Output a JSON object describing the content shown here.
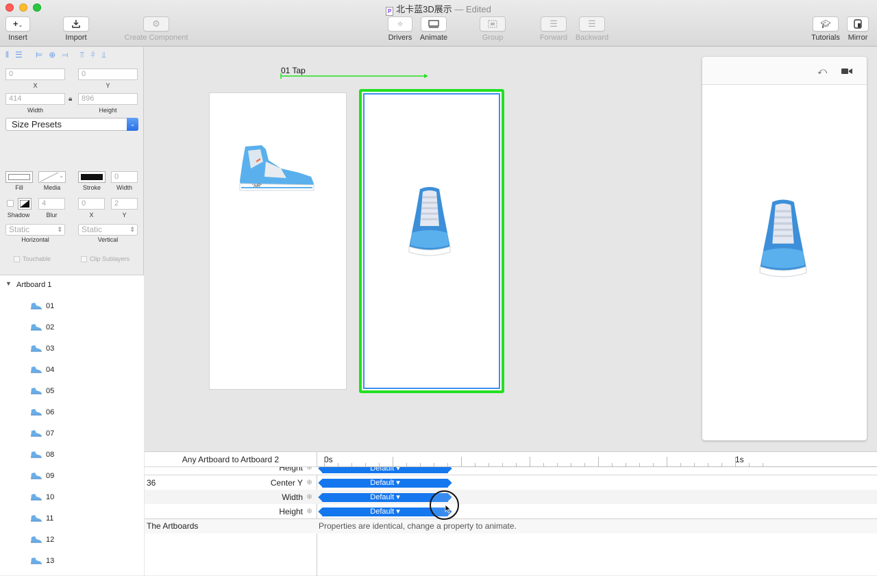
{
  "window": {
    "title": "北卡蓝3D展示",
    "status": "— Edited",
    "doc_icon": "P"
  },
  "toolbar": {
    "insert": "Insert",
    "import": "Import",
    "create_component": "Create Component",
    "drivers": "Drivers",
    "animate": "Animate",
    "group": "Group",
    "forward": "Forward",
    "backward": "Backward",
    "tutorials": "Tutorials",
    "mirror": "Mirror"
  },
  "inspector": {
    "x_value": "0",
    "x_label": "X",
    "y_value": "0",
    "y_label": "Y",
    "width_value": "414",
    "width_label": "Width",
    "height_value": "896",
    "height_label": "Height",
    "size_presets": "Size Presets",
    "fill_label": "Fill",
    "media_label": "Media",
    "stroke_label": "Stroke",
    "stroke_width_value": "0",
    "stroke_width_label": "Width",
    "shadow_label": "Shadow",
    "blur_value": "4",
    "blur_label": "Blur",
    "shadow_x_value": "0",
    "shadow_x_label": "X",
    "shadow_y_value": "2",
    "shadow_y_label": "Y",
    "horizontal_value": "Static",
    "horizontal_label": "Horizontal",
    "vertical_value": "Static",
    "vertical_label": "Vertical",
    "touchable": "Touchable",
    "clip_sublayers": "Clip Sublayers"
  },
  "layers": {
    "group": "Artboard 1",
    "items": [
      "01",
      "02",
      "03",
      "04",
      "05",
      "06",
      "07",
      "08",
      "09",
      "10",
      "11",
      "12",
      "13"
    ]
  },
  "canvas": {
    "connection_label": "01 Tap"
  },
  "timeline": {
    "transition": "Any Artboard to Artboard 2",
    "tick_0": "0s",
    "tick_1": "1s",
    "layer_value": "36",
    "rows": [
      {
        "label": "Height",
        "curve": "Default"
      },
      {
        "label": "Center Y",
        "curve": "Default"
      },
      {
        "label": "Width",
        "curve": "Default"
      },
      {
        "label": "Height",
        "curve": "Default"
      }
    ],
    "artboards_label": "The Artboards",
    "artboards_note": "Properties are identical, change a property to animate."
  },
  "colors": {
    "accent": "#1577ee",
    "selection": "#22e022",
    "close": "#fe5f57",
    "min": "#febb2e",
    "max": "#28c840"
  }
}
